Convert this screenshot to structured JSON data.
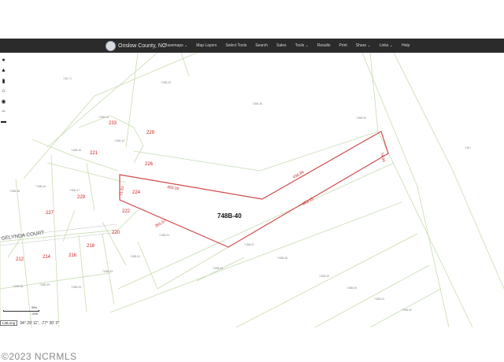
{
  "header": {
    "title": "Onslow County, NC",
    "menu": [
      "Basemaps ⌄",
      "Map Layers",
      "Select Tools",
      "Search",
      "Sales",
      "Tools ⌄",
      "Results",
      "Print",
      "Share ⌄",
      "Links ⌄",
      "Help"
    ]
  },
  "toolbar": {
    "icons": [
      "info-icon",
      "navigate-icon",
      "binoculars-icon",
      "home-icon",
      "location-pin-icon",
      "measure-icon",
      "trash-icon"
    ]
  },
  "map": {
    "selected_parcel": "748B-40",
    "street": "GELYNDA COURT",
    "addresses": [
      "233",
      "229",
      "221",
      "226",
      "224",
      "229",
      "227",
      "222",
      "220",
      "212",
      "214",
      "216",
      "218"
    ],
    "parcel_ids": [
      "748 J 2",
      "748B-43",
      "748B-44",
      "748B-42",
      "748B-45",
      "748B-46",
      "748B-47",
      "748B-48",
      "748B-49",
      "748B-50",
      "748B-51",
      "748B-52",
      "748B-53",
      "748B-54",
      "748B-55",
      "748B-56",
      "748B-57",
      "748B-58",
      "748B-59",
      "748B-60",
      "748B-61",
      "748B-62",
      "748B-63",
      "748 I"
    ],
    "side_lengths": [
      "450.00",
      "436.86",
      "71.61",
      "74.94",
      "653.15",
      "355.67"
    ]
  },
  "scale": {
    "top": "50m",
    "bottom": "100ft"
  },
  "coords": {
    "format": "LatLong",
    "value": "34° 29' 11\", -77° 30' 3\""
  },
  "watermark": "©2023 NCRMLS"
}
